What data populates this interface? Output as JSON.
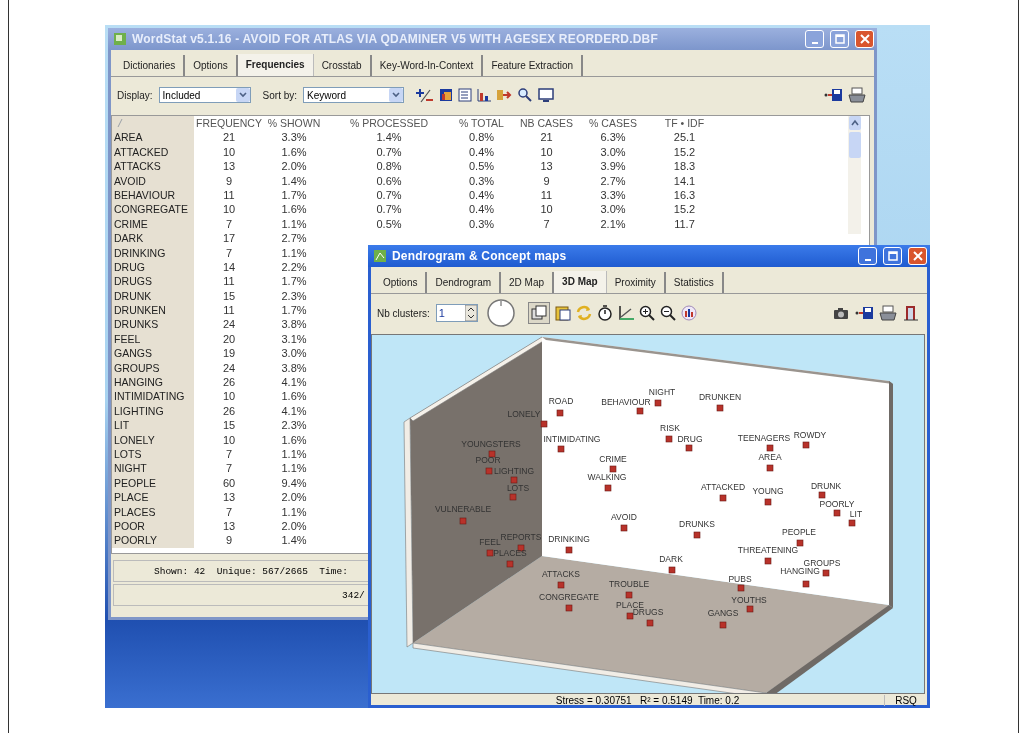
{
  "main_window": {
    "title": "WordStat v5.1.16 - AVOID FOR ATLAS VIA QDAMINER V5 WITH AGESEX REORDERD.DBF",
    "active": false,
    "tabs": [
      {
        "label": "Dictionaries",
        "selected": false
      },
      {
        "label": "Options",
        "selected": false
      },
      {
        "label": "Frequencies",
        "selected": true
      },
      {
        "label": "Crosstab",
        "selected": false
      },
      {
        "label": "Key-Word-In-Context",
        "selected": false
      },
      {
        "label": "Feature Extraction",
        "selected": false
      }
    ],
    "toolbar": {
      "display_label": "Display:",
      "display_value": "Included",
      "sort_label": "Sort by:",
      "sort_value": "Keyword"
    },
    "table": {
      "columns": [
        "FREQUENCY",
        "% SHOWN",
        "% PROCESSED",
        "% TOTAL",
        "NB CASES",
        "% CASES",
        "TF • IDF"
      ],
      "rows": [
        {
          "keyword": "AREA",
          "values": [
            "21",
            "3.3%",
            "1.4%",
            "0.8%",
            "21",
            "6.3%",
            "25.1"
          ]
        },
        {
          "keyword": "ATTACKED",
          "values": [
            "10",
            "1.6%",
            "0.7%",
            "0.4%",
            "10",
            "3.0%",
            "15.2"
          ]
        },
        {
          "keyword": "ATTACKS",
          "values": [
            "13",
            "2.0%",
            "0.8%",
            "0.5%",
            "13",
            "3.9%",
            "18.3"
          ]
        },
        {
          "keyword": "AVOID",
          "values": [
            "9",
            "1.4%",
            "0.6%",
            "0.3%",
            "9",
            "2.7%",
            "14.1"
          ]
        },
        {
          "keyword": "BEHAVIOUR",
          "values": [
            "11",
            "1.7%",
            "0.7%",
            "0.4%",
            "11",
            "3.3%",
            "16.3"
          ]
        },
        {
          "keyword": "CONGREGATE",
          "values": [
            "10",
            "1.6%",
            "0.7%",
            "0.4%",
            "10",
            "3.0%",
            "15.2"
          ]
        },
        {
          "keyword": "CRIME",
          "values": [
            "7",
            "1.1%",
            "0.5%",
            "0.3%",
            "7",
            "2.1%",
            "11.7"
          ]
        },
        {
          "keyword": "DARK",
          "values": [
            "17",
            "2.7%"
          ]
        },
        {
          "keyword": "DRINKING",
          "values": [
            "7",
            "1.1%"
          ]
        },
        {
          "keyword": "DRUG",
          "values": [
            "14",
            "2.2%"
          ]
        },
        {
          "keyword": "DRUGS",
          "values": [
            "11",
            "1.7%"
          ]
        },
        {
          "keyword": "DRUNK",
          "values": [
            "15",
            "2.3%"
          ]
        },
        {
          "keyword": "DRUNKEN",
          "values": [
            "11",
            "1.7%"
          ]
        },
        {
          "keyword": "DRUNKS",
          "values": [
            "24",
            "3.8%"
          ]
        },
        {
          "keyword": "FEEL",
          "values": [
            "20",
            "3.1%"
          ]
        },
        {
          "keyword": "GANGS",
          "values": [
            "19",
            "3.0%"
          ]
        },
        {
          "keyword": "GROUPS",
          "values": [
            "24",
            "3.8%"
          ]
        },
        {
          "keyword": "HANGING",
          "values": [
            "26",
            "4.1%"
          ]
        },
        {
          "keyword": "INTIMIDATING",
          "values": [
            "10",
            "1.6%"
          ]
        },
        {
          "keyword": "LIGHTING",
          "values": [
            "26",
            "4.1%"
          ]
        },
        {
          "keyword": "LIT",
          "values": [
            "15",
            "2.3%"
          ]
        },
        {
          "keyword": "LONELY",
          "values": [
            "10",
            "1.6%"
          ]
        },
        {
          "keyword": "LOTS",
          "values": [
            "7",
            "1.1%"
          ]
        },
        {
          "keyword": "NIGHT",
          "values": [
            "7",
            "1.1%"
          ]
        },
        {
          "keyword": "PEOPLE",
          "values": [
            "60",
            "9.4%"
          ]
        },
        {
          "keyword": "PLACE",
          "values": [
            "13",
            "2.0%"
          ]
        },
        {
          "keyword": "PLACES",
          "values": [
            "7",
            "1.1%"
          ]
        },
        {
          "keyword": "POOR",
          "values": [
            "13",
            "2.0%"
          ]
        },
        {
          "keyword": "POORLY",
          "values": [
            "9",
            "1.4%"
          ]
        }
      ]
    },
    "status_bar": [
      "Shown: 42  Unique: 567/2665  Time:",
      "342/"
    ]
  },
  "map_window": {
    "title": "Dendrogram & Concept maps",
    "active": true,
    "tabs": [
      {
        "label": "Options",
        "selected": false
      },
      {
        "label": "Dendrogram",
        "selected": false
      },
      {
        "label": "2D Map",
        "selected": false
      },
      {
        "label": "3D Map",
        "selected": true
      },
      {
        "label": "Proximity",
        "selected": false
      },
      {
        "label": "Statistics",
        "selected": false
      }
    ],
    "toolbar": {
      "clusters_label": "Nb clusters:",
      "clusters_value": "1"
    },
    "map_points": [
      {
        "label": "ROAD"
      },
      {
        "label": "LONELY"
      },
      {
        "label": "NIGHT"
      },
      {
        "label": "BEHAVIOUR"
      },
      {
        "label": "DRUNKEN"
      },
      {
        "label": "RISK"
      },
      {
        "label": "DRUG"
      },
      {
        "label": "TEENAGERS"
      },
      {
        "label": "ROWDY"
      },
      {
        "label": "YOUNGSTERS"
      },
      {
        "label": "INTIMIDATING"
      },
      {
        "label": "POOR"
      },
      {
        "label": "LIGHTING"
      },
      {
        "label": "LOTS"
      },
      {
        "label": "CRIME"
      },
      {
        "label": "AREA"
      },
      {
        "label": "WALKING"
      },
      {
        "label": "ATTACKED"
      },
      {
        "label": "YOUNG"
      },
      {
        "label": "DRUNK"
      },
      {
        "label": "POORLY"
      },
      {
        "label": "LIT"
      },
      {
        "label": "VULNERABLE"
      },
      {
        "label": "AVOID"
      },
      {
        "label": "DRUNKS"
      },
      {
        "label": "PEOPLE"
      },
      {
        "label": "REPORTS"
      },
      {
        "label": "FEEL"
      },
      {
        "label": "PLACES"
      },
      {
        "label": "DRINKING"
      },
      {
        "label": "THREATENING"
      },
      {
        "label": "DARK"
      },
      {
        "label": "GROUPS"
      },
      {
        "label": "HANGING"
      },
      {
        "label": "ATTACKS"
      },
      {
        "label": "PUBS"
      },
      {
        "label": "YOUTHS"
      },
      {
        "label": "TROUBLE"
      },
      {
        "label": "CONGREGATE"
      },
      {
        "label": "PLACE"
      },
      {
        "label": "DRUGS"
      },
      {
        "label": "GANGS"
      }
    ],
    "status_bar": {
      "stats": "Stress = 0.30751   R² = 0.5149  Time: 0.2",
      "rsq": "RSQ"
    }
  }
}
